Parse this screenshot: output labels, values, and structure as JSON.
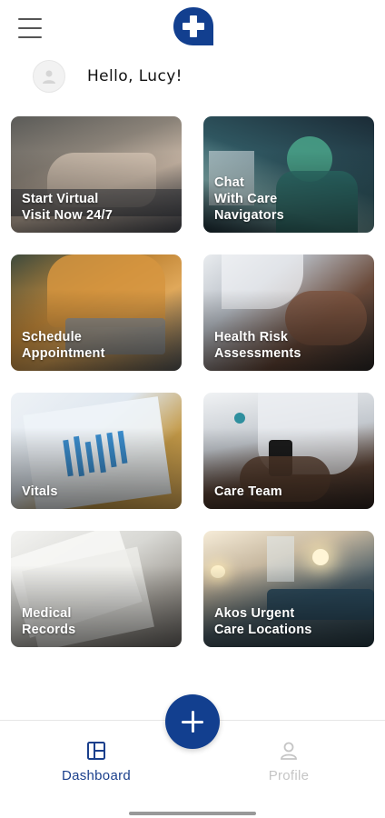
{
  "header": {
    "menu_icon": "hamburger-menu-icon",
    "logo_icon": "medical-cross-chat-logo",
    "brand_color": "#123f8f"
  },
  "greeting": {
    "text": "Hello, Lucy!",
    "avatar_icon": "user-avatar-icon"
  },
  "tiles": [
    {
      "label": "Start Virtual\nVisit Now 24/7"
    },
    {
      "label": "Chat\nWith Care\nNavigators"
    },
    {
      "label": "Schedule\nAppointment"
    },
    {
      "label": "Health Risk\nAssessments"
    },
    {
      "label": "Vitals"
    },
    {
      "label": "Care Team"
    },
    {
      "label": "Medical\nRecords"
    },
    {
      "label": "Akos Urgent\nCare Locations"
    }
  ],
  "fab": {
    "icon": "plus-icon"
  },
  "nav": {
    "items": [
      {
        "label": "Dashboard",
        "icon": "dashboard-icon",
        "active": true,
        "color": "#1a3f8c"
      },
      {
        "label": "Profile",
        "icon": "profile-icon",
        "active": false,
        "color": "#c5c5c5"
      }
    ]
  }
}
